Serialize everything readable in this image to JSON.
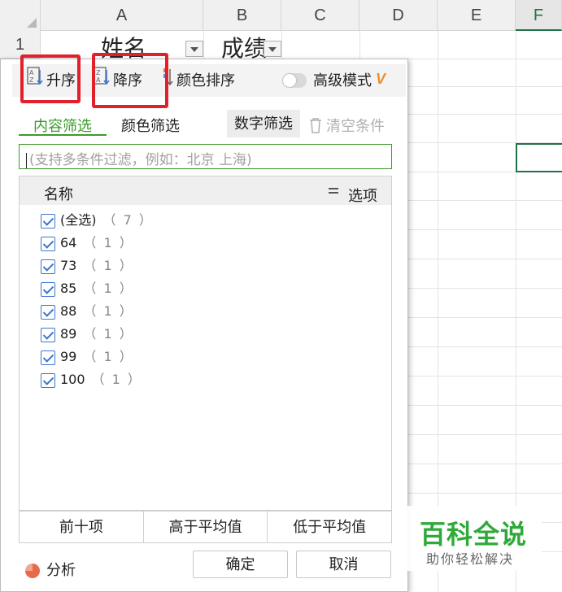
{
  "sheet": {
    "columns": [
      "A",
      "B",
      "C",
      "D",
      "E",
      "F"
    ],
    "active_column": "F",
    "row_numbers": [
      "1"
    ],
    "cells": {
      "a1": "姓名",
      "b1": "成绩"
    }
  },
  "filter_panel": {
    "toolbar": {
      "sort_asc": "升序",
      "sort_desc": "降序",
      "color_sort": "颜色排序",
      "advanced_mode": "高级模式",
      "vip_mark": "V"
    },
    "tabs": {
      "content": "内容筛选",
      "color": "颜色筛选"
    },
    "number_filter": "数字筛选",
    "clear_conditions": "清空条件",
    "search": {
      "placeholder": "(支持多条件过滤，例如：北京 上海)"
    },
    "list_header": {
      "name": "名称",
      "options": "选项"
    },
    "items": [
      {
        "label": "(全选)",
        "count": "（ 7 ）",
        "checked": true
      },
      {
        "label": "64",
        "count": "（ 1 ）",
        "checked": true
      },
      {
        "label": "73",
        "count": "（ 1 ）",
        "checked": true
      },
      {
        "label": "85",
        "count": "（ 1 ）",
        "checked": true
      },
      {
        "label": "88",
        "count": "（ 1 ）",
        "checked": true
      },
      {
        "label": "89",
        "count": "（ 1 ）",
        "checked": true
      },
      {
        "label": "99",
        "count": "（ 1 ）",
        "checked": true
      },
      {
        "label": "100",
        "count": "（ 1 ）",
        "checked": true
      }
    ],
    "quick_filters": {
      "top10": "前十项",
      "above_avg": "高于平均值",
      "below_avg": "低于平均值"
    },
    "analyze": "分析",
    "ok": "确定",
    "cancel": "取消"
  },
  "watermark": {
    "title": "百科全说",
    "subtitle": "助你轻松解决"
  },
  "colors": {
    "accent_green": "#3d9a2b",
    "highlight_red": "#e0202a",
    "checkbox_blue": "#3c76d0",
    "vip_orange": "#f08c2a"
  },
  "icons": [
    "sort-ascending-icon",
    "sort-descending-icon",
    "color-sort-icon",
    "trash-icon",
    "options-icon",
    "pie-chart-icon",
    "dropdown-arrow-icon"
  ]
}
